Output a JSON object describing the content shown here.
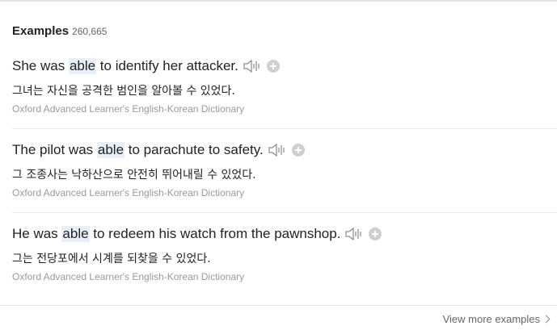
{
  "header": {
    "title": "Examples",
    "count": "260,665"
  },
  "examples": [
    {
      "pre": "She was ",
      "keyword": "able",
      "post": " to identify her attacker.",
      "translation": "그녀는 자신을 공격한 범인을 알아볼 수 있었다.",
      "source": "Oxford Advanced Learner's English-Korean Dictionary"
    },
    {
      "pre": "The pilot was ",
      "keyword": "able",
      "post": " to parachute to safety.",
      "translation": "그 조종사는 낙하산으로 안전히 뛰어내릴 수 있었다.",
      "source": "Oxford Advanced Learner's English-Korean Dictionary"
    },
    {
      "pre": "He was ",
      "keyword": "able",
      "post": " to redeem his watch from the pawnshop.",
      "translation": "그는 전당포에서 시계를 되찾을 수 있었다.",
      "source": "Oxford Advanced Learner's English-Korean Dictionary"
    }
  ],
  "footer": {
    "view_more_label": "View more examples"
  },
  "icons": {
    "speaker": "speaker-icon",
    "add": "plus-circle-icon",
    "chevron": "chevron-right-icon"
  },
  "colors": {
    "highlight": "#e9eff8",
    "source_text": "#9a9a9a"
  }
}
